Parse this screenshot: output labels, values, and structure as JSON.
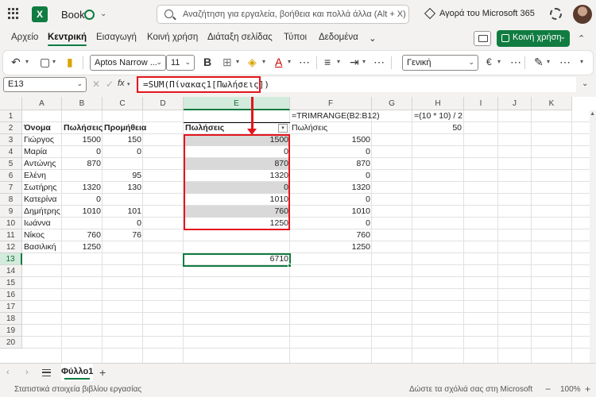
{
  "app": {
    "logo_text": "X",
    "book_title": "Book",
    "search_placeholder": "Αναζήτηση για εργαλεία, βοήθεια και πολλά άλλα (Alt + X)",
    "ms365_label": "Αγορά του Microsoft 365"
  },
  "ribbon": {
    "tabs": [
      "Αρχείο",
      "Κεντρική",
      "Εισαγωγή",
      "Κοινή χρήση",
      "Διάταξη σελίδας",
      "Τύποι",
      "Δεδομένα"
    ],
    "more": "⌄",
    "active_tab": "Κεντρική",
    "share_label": "Κοινή χρήση",
    "font_name": "Aptos Narrow ...",
    "font_size": "11",
    "number_format": "Γενική",
    "currency_label": "€",
    "bold_label": "B",
    "text_color_label": "A"
  },
  "formula_bar": {
    "name_box": "E13",
    "fx_label": "fx",
    "formula": "=SUM(Πίνακας1[Πωλήσεις])"
  },
  "grid": {
    "columns": [
      "A",
      "B",
      "C",
      "D",
      "E",
      "F",
      "G",
      "H",
      "I",
      "J",
      "K"
    ],
    "selected_column": "E",
    "rows": [
      "1",
      "2",
      "3",
      "4",
      "5",
      "6",
      "7",
      "8",
      "9",
      "10",
      "11",
      "12",
      "13",
      "14",
      "15",
      "16",
      "17",
      "18",
      "19",
      "20"
    ],
    "selected_row": "13",
    "headers": {
      "a2": "Όνομα",
      "b2": "Πωλήσεις",
      "c2": "Προμήθεια",
      "e2": "Πωλήσεις",
      "f2": "Πωλήσεις"
    },
    "f1": "=TRIMRANGE(B2:B12)",
    "h1": "=(10 * 10) / 2",
    "h2": "50",
    "names": [
      "Γιώργος",
      "Μαρία",
      "Αντώνης",
      "Ελένη",
      "Σωτήρης",
      "Κατερίνα",
      "Δημήτρης",
      "Ιωάννα",
      "Νίκος",
      "Βασιλική"
    ],
    "sales": [
      "1500",
      "0",
      "870",
      "",
      "1320",
      "0",
      "1010",
      "",
      "760",
      "1250"
    ],
    "commission": [
      "150",
      "0",
      "",
      "95",
      "130",
      "",
      "101",
      "0",
      "76",
      ""
    ],
    "table_sales": [
      "1500",
      "0",
      "870",
      "1320",
      "0",
      "1010",
      "760",
      "1250"
    ],
    "trim_sales": [
      "1500",
      "0",
      "870",
      "0",
      "1320",
      "0",
      "1010",
      "0",
      "760",
      "1250"
    ],
    "e13": "6710"
  },
  "sheets": {
    "active": "Φύλλο1",
    "add": "+"
  },
  "status": {
    "left": "Στατιστικά στοιχεία βιβλίου εργασίας",
    "mid": "Δώστε τα σχόλιά σας στη Microsoft",
    "zoom": "100%",
    "zoom_minus": "−",
    "zoom_plus": "+"
  }
}
